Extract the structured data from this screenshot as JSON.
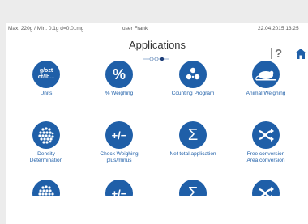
{
  "status": {
    "capacity": "Max. 220g / Min. 0.1g  d=0.01mg",
    "user": "user Frank",
    "datetime": "22.04.2015  13:25"
  },
  "header": {
    "title": "Applications",
    "help_glyph": "?",
    "home_icon": "home-icon"
  },
  "apps": [
    {
      "label": "Units",
      "icon": "units-icon",
      "icon_text": "g/ozt\nct/lb..."
    },
    {
      "label": "% Weighing",
      "icon": "percent-icon",
      "icon_text": "%"
    },
    {
      "label": "Counting Program",
      "icon": "counting-icon",
      "icon_text": ""
    },
    {
      "label": "Animal Weighing",
      "icon": "animal-icon",
      "icon_text": ""
    },
    {
      "label": "Density\nDetermination",
      "icon": "density-icon",
      "icon_text": ""
    },
    {
      "label": "Check Weighing\nplus/minus",
      "icon": "plus-minus-icon",
      "icon_text": "+/−"
    },
    {
      "label": "Net total application",
      "icon": "sigma-icon",
      "icon_text": "Σ"
    },
    {
      "label": "Free conversion\nArea conversion",
      "icon": "conversion-icon",
      "icon_text": ""
    }
  ],
  "colors": {
    "accent": "#1f5fa8",
    "background": "#ececec"
  }
}
